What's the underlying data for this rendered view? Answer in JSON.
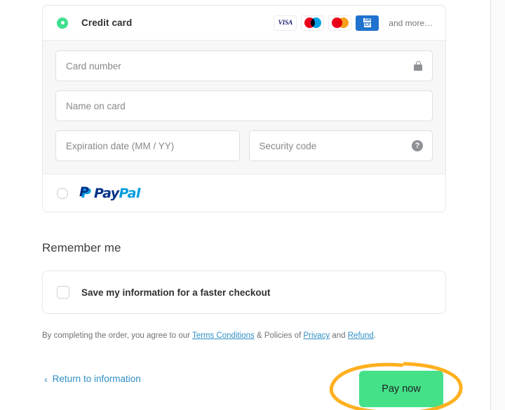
{
  "payment": {
    "credit_card": {
      "label": "Credit card",
      "selected": true,
      "brands": [
        {
          "name": "visa-card-icon",
          "text": "VISA"
        },
        {
          "name": "maestro-card-icon",
          "text": ""
        },
        {
          "name": "mastercard-card-icon",
          "text": ""
        },
        {
          "name": "amex-card-icon",
          "text": "AMEX"
        }
      ],
      "more_text": "and more…",
      "fields": {
        "card_number": {
          "placeholder": "Card number",
          "value": "",
          "icon": "lock-icon"
        },
        "name_on_card": {
          "placeholder": "Name on card",
          "value": ""
        },
        "expiration": {
          "placeholder": "Expiration date (MM / YY)",
          "value": ""
        },
        "security_code": {
          "placeholder": "Security code",
          "value": "",
          "icon": "help-icon",
          "icon_glyph": "?"
        }
      }
    },
    "paypal": {
      "label": "PayPal",
      "logo_first": "Pay",
      "logo_second": "Pal",
      "selected": false
    }
  },
  "remember": {
    "title": "Remember me",
    "checkbox_label": "Save my information for a faster checkout",
    "checked": false
  },
  "disclaimer": {
    "prefix": "By completing the order, you agree to our ",
    "terms_link": "Terms Conditions",
    "middle": " & Policies of ",
    "privacy_link": "Privacy",
    "and": " and ",
    "refund_link": "Refund",
    "suffix": "."
  },
  "footer": {
    "return_label": "Return to information",
    "return_chevron": "‹",
    "pay_label": "Pay now"
  },
  "colors": {
    "accent_green": "#45e188",
    "radio_green": "#3fdf8e",
    "link_blue": "#2f8fc4",
    "annotation_orange": "#ffb01f",
    "visa_blue": "#1a1f71",
    "amex_blue": "#1f72cd",
    "paypal_dark": "#003087",
    "paypal_light": "#009cde"
  }
}
